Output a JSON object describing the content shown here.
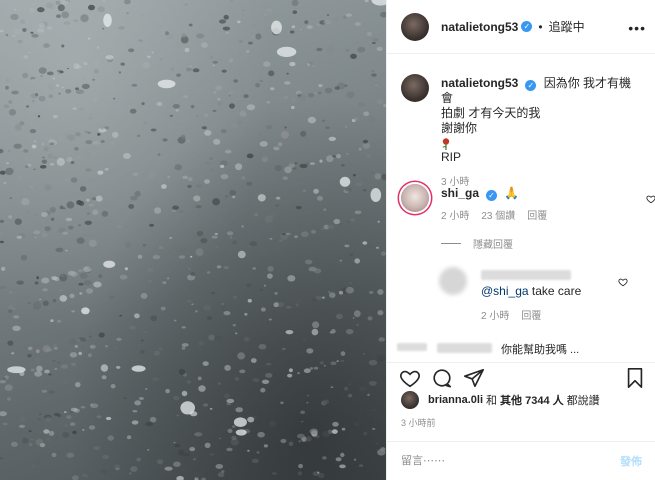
{
  "post": {
    "image_alt": "gravel ground",
    "header": {
      "username": "natalietong53",
      "separator": "•",
      "follow_state": "追蹤中",
      "more_icon": "more-horizontal-icon"
    },
    "caption": {
      "username": "natalietong53",
      "line1": "因為你 我才有機會",
      "line2": "拍劇 才有今天的我",
      "line3": "謝謝你",
      "emoji": "rose",
      "line4": "RIP",
      "time": "3 小時"
    },
    "comments": [
      {
        "username": "shi_ga",
        "text": "🙏",
        "time": "2 小時",
        "likes": "23 個讚",
        "reply": "回覆",
        "hide_replies": "隱藏回覆"
      },
      {
        "username_redacted": true,
        "text_prefix": "@shi_ga",
        "text": "take care",
        "time": "2 小時",
        "reply": "回覆"
      },
      {
        "username_redacted": true,
        "text_visible": "你能幫助我嗎 ..."
      }
    ],
    "likes": {
      "user": "brianna.0li",
      "and": "和",
      "others": "其他 7344 人",
      "suffix": "都說讚"
    },
    "time_ago": "3 小時前",
    "add_comment": {
      "placeholder": "留言⋯⋯",
      "post_label": "發佈"
    },
    "colors": {
      "verified": "#3897f0",
      "post_disabled": "#b2dffc",
      "meta_text": "#8e8e8e",
      "mention": "#00376b"
    }
  }
}
